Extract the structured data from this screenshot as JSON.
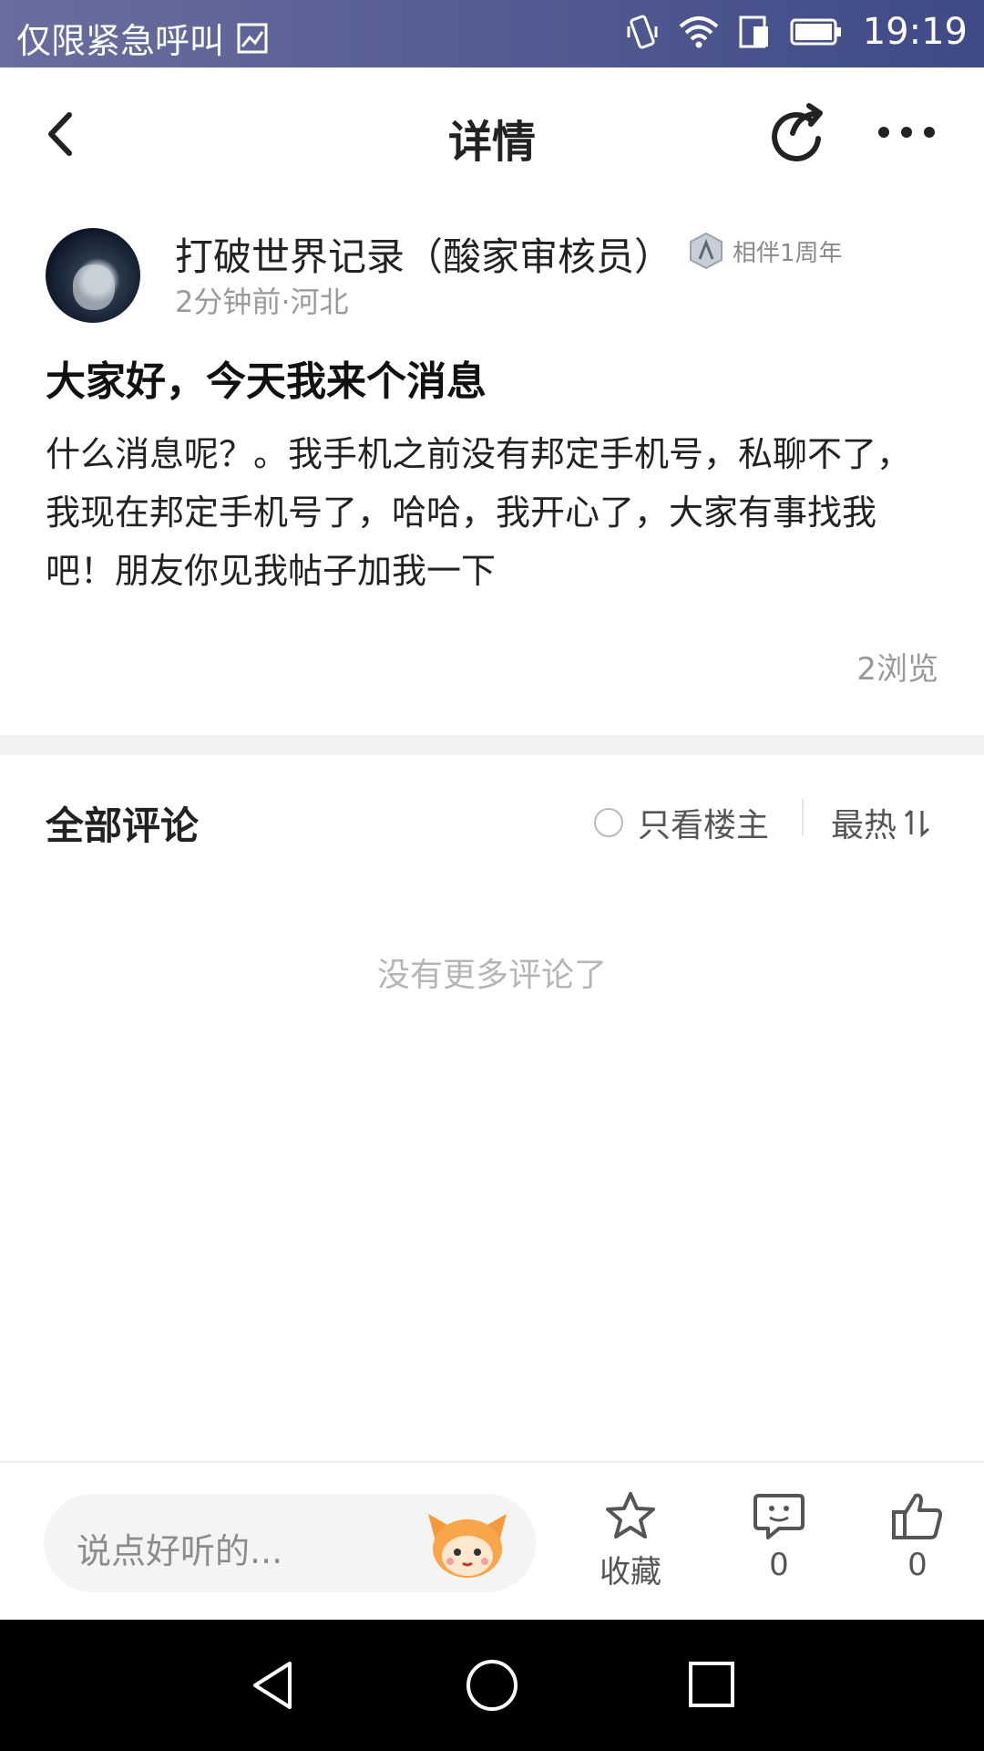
{
  "status_bar": {
    "carrier": "仅限紧急呼叫",
    "time": "19:19",
    "icons": [
      "image-icon",
      "vibrate-icon",
      "wifi-icon",
      "sim-icon",
      "battery-icon"
    ]
  },
  "nav": {
    "title": "详情",
    "icons": [
      "back-icon",
      "share-icon",
      "more-icon"
    ]
  },
  "author": {
    "name": "打破世界记录（酸家审核员）",
    "badge": "相伴1周年",
    "meta": "2分钟前·河北"
  },
  "post": {
    "title": "大家好，今天我来个消息",
    "body": "什么消息呢？。我手机之前没有邦定手机号，私聊不了，我现在邦定手机号了，哈哈，我开心了，大家有事找我吧！朋友你见我帖子加我一下",
    "views": "2浏览"
  },
  "comments": {
    "title": "全部评论",
    "op_only": "只看楼主",
    "sort": "最热",
    "empty": "没有更多评论了"
  },
  "bottom_bar": {
    "input_placeholder": "说点好听的...",
    "favorite_label": "收藏",
    "comment_count": "0",
    "like_count": "0"
  },
  "colors": {
    "status_bar_start": "#6a6e9e",
    "status_bar_end": "#3f4a86",
    "text_primary": "#222222",
    "text_secondary": "#999999"
  }
}
